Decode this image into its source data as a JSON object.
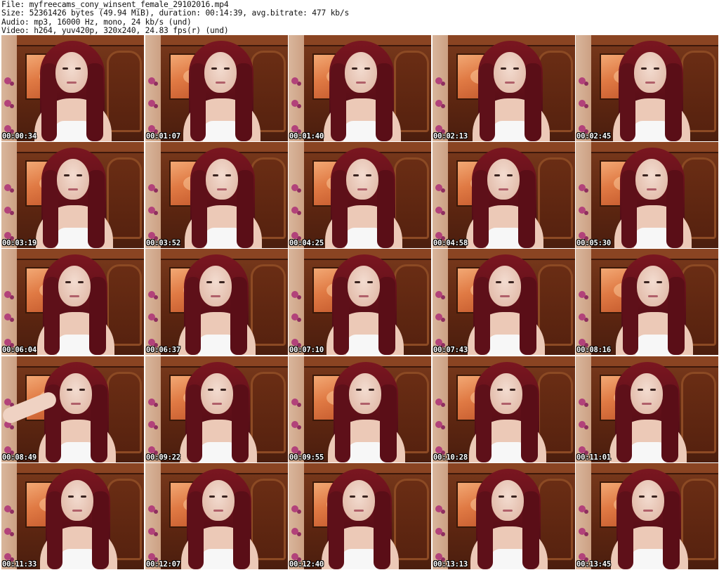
{
  "header": {
    "file_line": "File: myfreecams_cony_winsent_female_29102016.mp4",
    "size_line": "Size: 52361426 bytes (49.94 MiB), duration: 00:14:39, avg.bitrate: 477 kb/s",
    "audio_line": "Audio: mp3, 16000 Hz, mono, 24 kb/s (und)",
    "video_line": "Video: h264, yuv420p, 320x240, 24.83 fps(r) (und)"
  },
  "thumbnails": [
    {
      "timestamp": "00:00:34"
    },
    {
      "timestamp": "00:01:07"
    },
    {
      "timestamp": "00:01:40"
    },
    {
      "timestamp": "00:02:13"
    },
    {
      "timestamp": "00:02:45"
    },
    {
      "timestamp": "00:03:19"
    },
    {
      "timestamp": "00:03:52"
    },
    {
      "timestamp": "00:04:25"
    },
    {
      "timestamp": "00:04:58"
    },
    {
      "timestamp": "00:05:30"
    },
    {
      "timestamp": "00:06:04"
    },
    {
      "timestamp": "00:06:37"
    },
    {
      "timestamp": "00:07:10"
    },
    {
      "timestamp": "00:07:43"
    },
    {
      "timestamp": "00:08:16"
    },
    {
      "timestamp": "00:08:49"
    },
    {
      "timestamp": "00:09:22"
    },
    {
      "timestamp": "00:09:55"
    },
    {
      "timestamp": "00:10:28"
    },
    {
      "timestamp": "00:11:01"
    },
    {
      "timestamp": "00:11:33"
    },
    {
      "timestamp": "00:12:07"
    },
    {
      "timestamp": "00:12:40"
    },
    {
      "timestamp": "00:13:13"
    },
    {
      "timestamp": "00:13:45"
    }
  ]
}
